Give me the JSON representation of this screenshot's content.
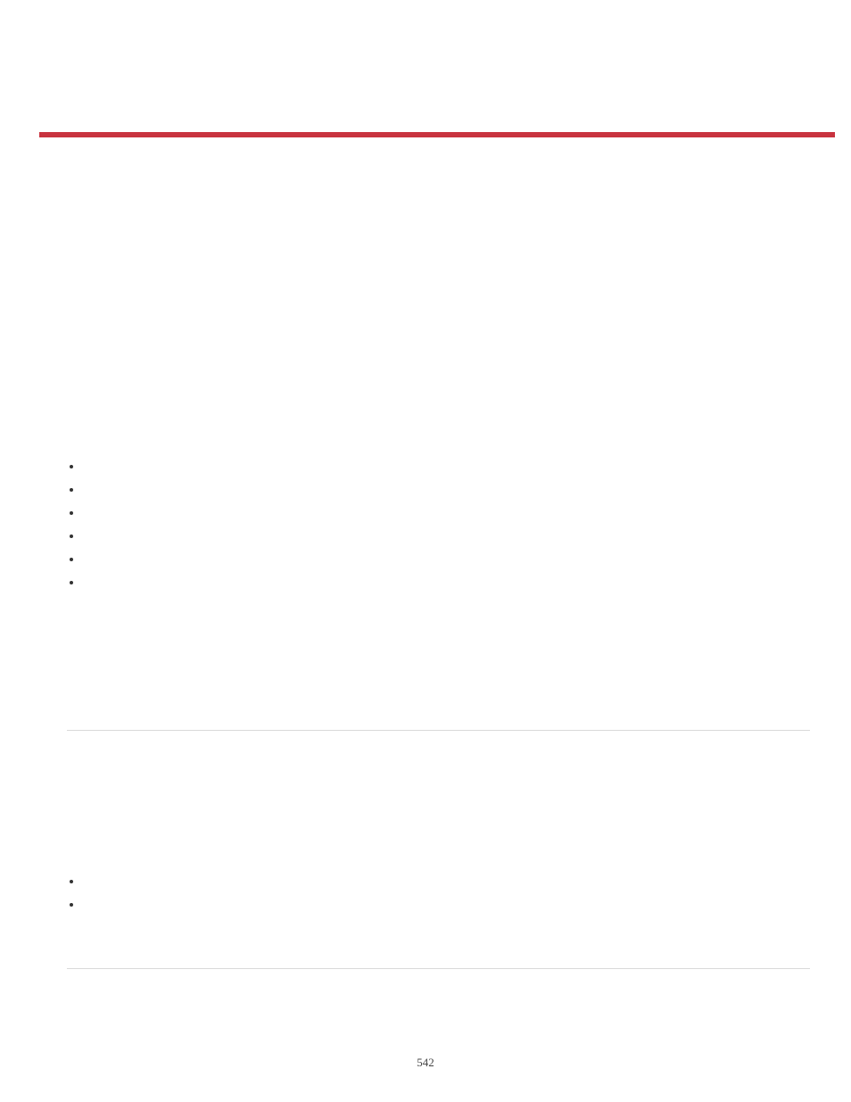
{
  "page_number": "542",
  "list1": {
    "items": [
      "",
      "",
      "",
      "",
      "",
      ""
    ]
  },
  "list2": {
    "items": [
      "",
      ""
    ]
  }
}
